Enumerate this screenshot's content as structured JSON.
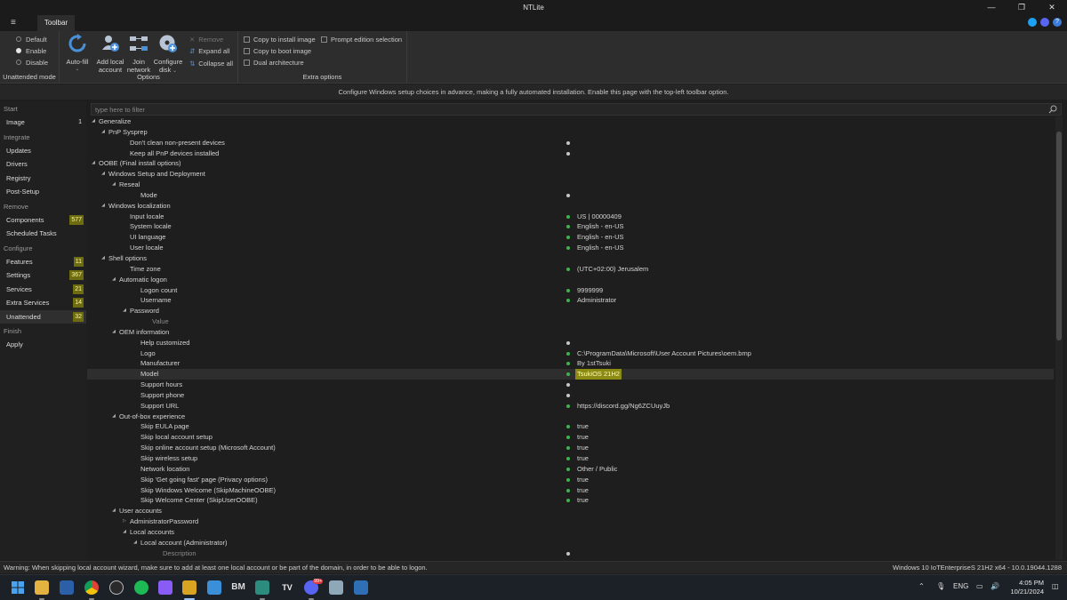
{
  "window": {
    "title": "NTLite"
  },
  "tabs": {
    "menu": "≡",
    "toolbar": "Toolbar"
  },
  "ribbon": {
    "unattended": {
      "label": "Unattended mode",
      "options": [
        "Default",
        "Enable",
        "Disable"
      ],
      "selected": "Enable"
    },
    "options_group": {
      "label": "Options",
      "autofill": "Auto-fill",
      "add_local_1": "Add local",
      "add_local_2": "account",
      "join_1": "Join",
      "join_2": "network",
      "configure_1": "Configure",
      "configure_2": "disk",
      "remove": "Remove",
      "expand_all": "Expand all",
      "collapse_all": "Collapse all"
    },
    "extra_group": {
      "label": "Extra options",
      "copy_install": "Copy to install image",
      "copy_boot": "Copy to boot image",
      "dual_arch": "Dual architecture",
      "prompt_edition": "Prompt edition selection"
    }
  },
  "info_text": "Configure Windows setup choices in advance, making a fully automated installation. Enable this page with the top-left toolbar option.",
  "filter": {
    "placeholder": "type here to filter"
  },
  "sidebar": {
    "start": "Start",
    "image": {
      "label": "Image",
      "badge": "1"
    },
    "integrate": "Integrate",
    "updates": "Updates",
    "drivers": "Drivers",
    "registry": "Registry",
    "post_setup": "Post-Setup",
    "remove": "Remove",
    "components": {
      "label": "Components",
      "badge": "577"
    },
    "scheduled_tasks": "Scheduled Tasks",
    "configure": "Configure",
    "features": {
      "label": "Features",
      "badge": "11"
    },
    "settings": {
      "label": "Settings",
      "badge": "367"
    },
    "services": {
      "label": "Services",
      "badge": "21"
    },
    "extra_services": {
      "label": "Extra Services",
      "badge": "14"
    },
    "unattended": {
      "label": "Unattended",
      "badge": "32"
    },
    "finish": "Finish",
    "apply": "Apply"
  },
  "tree": [
    {
      "label": "Generalize",
      "level": 0,
      "arrow": "open",
      "dot": "",
      "value": ""
    },
    {
      "label": "PnP Sysprep",
      "level": 1,
      "arrow": "open",
      "dot": "",
      "value": ""
    },
    {
      "label": "Don't clean non-present devices",
      "level": 3,
      "arrow": "",
      "dot": "w",
      "value": ""
    },
    {
      "label": "Keep all PnP devices installed",
      "level": 3,
      "arrow": "",
      "dot": "w",
      "value": ""
    },
    {
      "label": "OOBE (Final install options)",
      "level": 0,
      "arrow": "open",
      "dot": "",
      "value": ""
    },
    {
      "label": "Windows Setup and Deployment",
      "level": 1,
      "arrow": "open",
      "dot": "",
      "value": ""
    },
    {
      "label": "Reseal",
      "level": 2,
      "arrow": "open",
      "dot": "",
      "value": ""
    },
    {
      "label": "Mode",
      "level": 4,
      "arrow": "",
      "dot": "w",
      "value": ""
    },
    {
      "label": "Windows localization",
      "level": 1,
      "arrow": "open",
      "dot": "",
      "value": ""
    },
    {
      "label": "Input locale",
      "level": 3,
      "arrow": "",
      "dot": "g",
      "value": "US | 00000409"
    },
    {
      "label": "System locale",
      "level": 3,
      "arrow": "",
      "dot": "g",
      "value": "English - en-US"
    },
    {
      "label": "UI language",
      "level": 3,
      "arrow": "",
      "dot": "g",
      "value": "English - en-US"
    },
    {
      "label": "User locale",
      "level": 3,
      "arrow": "",
      "dot": "g",
      "value": "English - en-US"
    },
    {
      "label": "Shell options",
      "level": 1,
      "arrow": "open",
      "dot": "",
      "value": ""
    },
    {
      "label": "Time zone",
      "level": 3,
      "arrow": "",
      "dot": "g",
      "value": "(UTC+02:00) Jerusalem"
    },
    {
      "label": "Automatic logon",
      "level": 2,
      "arrow": "open",
      "dot": "",
      "value": ""
    },
    {
      "label": "Logon count",
      "level": 4,
      "arrow": "",
      "dot": "g",
      "value": "9999999"
    },
    {
      "label": "Username",
      "level": 4,
      "arrow": "",
      "dot": "g",
      "value": "Administrator"
    },
    {
      "label": "Password",
      "level": 3,
      "arrow": "open",
      "dot": "",
      "value": ""
    },
    {
      "label": "Value",
      "level": 5,
      "arrow": "",
      "dot": "",
      "value": "",
      "dim": true
    },
    {
      "label": "OEM information",
      "level": 2,
      "arrow": "open",
      "dot": "",
      "value": ""
    },
    {
      "label": "Help customized",
      "level": 4,
      "arrow": "",
      "dot": "w",
      "value": ""
    },
    {
      "label": "Logo",
      "level": 4,
      "arrow": "",
      "dot": "g",
      "value": "C:\\ProgramData\\Microsoft\\User Account Pictures\\oem.bmp"
    },
    {
      "label": "Manufacturer",
      "level": 4,
      "arrow": "",
      "dot": "g",
      "value": "By 1stTsuki"
    },
    {
      "label": "Model",
      "level": 4,
      "arrow": "",
      "dot": "g",
      "value": "TsukiOS 21H2",
      "selected": true,
      "highlight": true
    },
    {
      "label": "Support hours",
      "level": 4,
      "arrow": "",
      "dot": "w",
      "value": ""
    },
    {
      "label": "Support phone",
      "level": 4,
      "arrow": "",
      "dot": "w",
      "value": ""
    },
    {
      "label": "Support URL",
      "level": 4,
      "arrow": "",
      "dot": "g",
      "value": "https://discord.gg/Ng6ZCUuyJb"
    },
    {
      "label": "Out-of-box experience",
      "level": 2,
      "arrow": "open",
      "dot": "",
      "value": ""
    },
    {
      "label": "Skip EULA page",
      "level": 4,
      "arrow": "",
      "dot": "g",
      "value": "true"
    },
    {
      "label": "Skip local account setup",
      "level": 4,
      "arrow": "",
      "dot": "g",
      "value": "true"
    },
    {
      "label": "Skip online account setup (Microsoft Account)",
      "level": 4,
      "arrow": "",
      "dot": "g",
      "value": "true"
    },
    {
      "label": "Skip wireless setup",
      "level": 4,
      "arrow": "",
      "dot": "g",
      "value": "true"
    },
    {
      "label": "Network location",
      "level": 4,
      "arrow": "",
      "dot": "g",
      "value": "Other / Public"
    },
    {
      "label": "Skip 'Get going fast' page (Privacy options)",
      "level": 4,
      "arrow": "",
      "dot": "g",
      "value": "true"
    },
    {
      "label": "Skip Windows Welcome (SkipMachineOOBE)",
      "level": 4,
      "arrow": "",
      "dot": "g",
      "value": "true"
    },
    {
      "label": "Skip Welcome Center (SkipUserOOBE)",
      "level": 4,
      "arrow": "",
      "dot": "g",
      "value": "true"
    },
    {
      "label": "User accounts",
      "level": 2,
      "arrow": "open",
      "dot": "",
      "value": ""
    },
    {
      "label": "AdministratorPassword",
      "level": 3,
      "arrow": "closed",
      "dot": "",
      "value": ""
    },
    {
      "label": "Local accounts",
      "level": 3,
      "arrow": "open",
      "dot": "",
      "value": ""
    },
    {
      "label": "Local account (Administrator)",
      "level": 4,
      "arrow": "open",
      "dot": "",
      "value": ""
    },
    {
      "label": "Description",
      "level": 6,
      "arrow": "",
      "dot": "w",
      "value": "",
      "dim": true
    }
  ],
  "status": {
    "warning": "Warning: When skipping local account wizard, make sure to add at least one local account or be part of the domain, in order to be able to logon.",
    "edition": "Windows 10 IoTEnterpriseS 21H2 x64 - 10.0.19044.1288"
  },
  "taskbar": {
    "lang": "ENG",
    "time": "4:05 PM",
    "date": "10/21/2024",
    "discord_badge": "99+",
    "icons": [
      "windows-start",
      "file-explorer",
      "microsoft-store",
      "chrome",
      "steam",
      "spotify",
      "obsidian",
      "ntlite",
      "app-blue",
      "bm-app",
      "vs-code",
      "tradingview",
      "discord",
      "feather-app",
      "app-26"
    ]
  },
  "colors": {
    "badge_bg": "#6d6c10",
    "value_highlight": "#8b8b14",
    "dot_green": "#3db44b",
    "accent_blue": "#4a90d9"
  }
}
